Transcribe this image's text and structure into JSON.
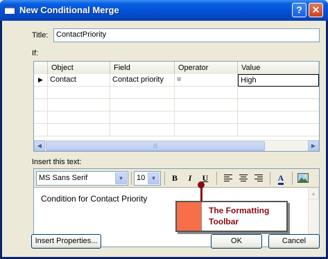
{
  "window": {
    "title": "New Conditional Merge",
    "help_glyph": "?",
    "close_glyph": "✕"
  },
  "title_field": {
    "label": "Title:",
    "value": "ContactPriority"
  },
  "if_section": {
    "label": "If:",
    "columns": [
      "Object",
      "Field",
      "Operator",
      "Value"
    ],
    "rows": [
      {
        "indicator": "▶",
        "object": "Contact",
        "field": "Contact priority",
        "operator": "=",
        "value": "High"
      }
    ],
    "scroll_left": "◀",
    "scroll_right": "▶",
    "thumb_grip": "|||"
  },
  "insert_section": {
    "label": "Insert this text:",
    "font_name": "MS Sans Serif",
    "font_size": "10",
    "bold": "B",
    "italic": "I",
    "underline": "U",
    "font_color_glyph": "A",
    "body_text": "Condition for Contact Priority",
    "scroll_up": "▲",
    "scroll_down": "▼",
    "dropdown_arrow": "▼"
  },
  "callout": {
    "text": "The Formatting\nToolbar",
    "swatch_color": "#f76e4b",
    "text_color": "#8b0a12"
  },
  "buttons": {
    "insert_properties": "Insert Properties...",
    "ok": "OK",
    "cancel": "Cancel"
  }
}
